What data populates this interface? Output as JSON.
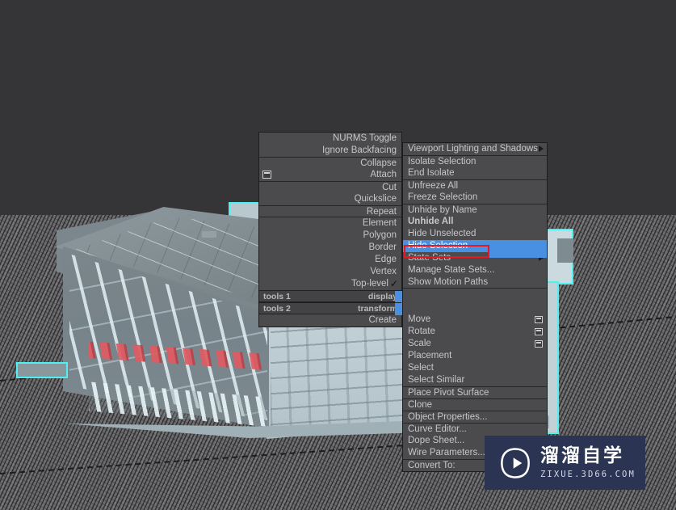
{
  "app": {
    "background_color": "#353436",
    "viewport_label": "3ds-max-perspective-viewport"
  },
  "scene": {
    "object_name": "building-model",
    "selection_color": "#4ff0f0",
    "ground_color": "#6d6c6e"
  },
  "left_menu": {
    "name": "quad-menu-left",
    "groups": [
      {
        "items": [
          {
            "label": "NURMS Toggle",
            "enabled": false
          },
          {
            "label": "Ignore Backfacing",
            "enabled": false
          }
        ]
      },
      {
        "items": [
          {
            "label": "Collapse",
            "enabled": false
          },
          {
            "label": "Attach",
            "enabled": false,
            "settings_icon": true
          }
        ]
      },
      {
        "items": [
          {
            "label": "Cut",
            "enabled": false
          },
          {
            "label": "Quickslice",
            "enabled": false
          }
        ]
      },
      {
        "items": [
          {
            "label": "Repeat",
            "enabled": false
          }
        ]
      },
      {
        "items": [
          {
            "label": "Element",
            "enabled": false
          },
          {
            "label": "Polygon",
            "enabled": false
          },
          {
            "label": "Border",
            "enabled": false
          },
          {
            "label": "Edge",
            "enabled": false
          },
          {
            "label": "Vertex",
            "enabled": false
          },
          {
            "label": "Top-level",
            "enabled": true,
            "checked": true
          }
        ]
      }
    ],
    "titlebars": [
      {
        "left": "tools 1",
        "right": "display"
      },
      {
        "left": "tools 2",
        "right": "transform"
      }
    ],
    "footer": {
      "label": "Create"
    }
  },
  "right_menu": {
    "name": "quad-menu-right",
    "groups": [
      {
        "items": [
          {
            "label": "Viewport Lighting and Shadows",
            "submenu": true
          }
        ]
      },
      {
        "items": [
          {
            "label": "Isolate Selection"
          },
          {
            "label": "End Isolate"
          }
        ]
      },
      {
        "items": [
          {
            "label": "Unfreeze All"
          },
          {
            "label": "Freeze Selection"
          }
        ]
      },
      {
        "items": [
          {
            "label": "Unhide by Name"
          },
          {
            "label": "Unhide All",
            "bold": true
          },
          {
            "label": "Hide Unselected"
          },
          {
            "label": "Hide Selection",
            "highlighted": true,
            "annotated": true
          },
          {
            "label": "State Sets",
            "submenu": true
          },
          {
            "label": "Manage State Sets..."
          },
          {
            "label": "Show Motion Paths"
          }
        ]
      },
      {
        "items": [
          {
            "label": "Move",
            "settings_icon": true
          },
          {
            "label": "Rotate",
            "settings_icon": true
          },
          {
            "label": "Scale",
            "settings_icon": true
          },
          {
            "label": "Placement"
          },
          {
            "label": "Select"
          },
          {
            "label": "Select Similar"
          }
        ]
      },
      {
        "items": [
          {
            "label": "Place Pivot Surface"
          }
        ]
      },
      {
        "items": [
          {
            "label": "Clone"
          }
        ]
      },
      {
        "items": [
          {
            "label": "Object Properties..."
          }
        ]
      },
      {
        "items": [
          {
            "label": "Curve Editor..."
          },
          {
            "label": "Dope Sheet..."
          },
          {
            "label": "Wire Parameters..."
          }
        ]
      },
      {
        "items": [
          {
            "label": "Convert To:",
            "submenu": false
          }
        ]
      }
    ]
  },
  "annotation": {
    "name": "red-highlight-box",
    "target": "Hide Selection",
    "color": "#e8161d"
  },
  "colors": {
    "menu_background": "#4b4a4c",
    "menu_text": "#c6c6c8",
    "highlight_blue": "#4a90e2",
    "selection_cyan": "#4ff0f0",
    "annotation_red": "#e8161d",
    "watermark_bg": "#2b3453"
  },
  "watermark": {
    "name": "zixue-watermark",
    "brand_cn": "溜溜自学",
    "brand_url": "ZIXUE.3D66.COM"
  }
}
